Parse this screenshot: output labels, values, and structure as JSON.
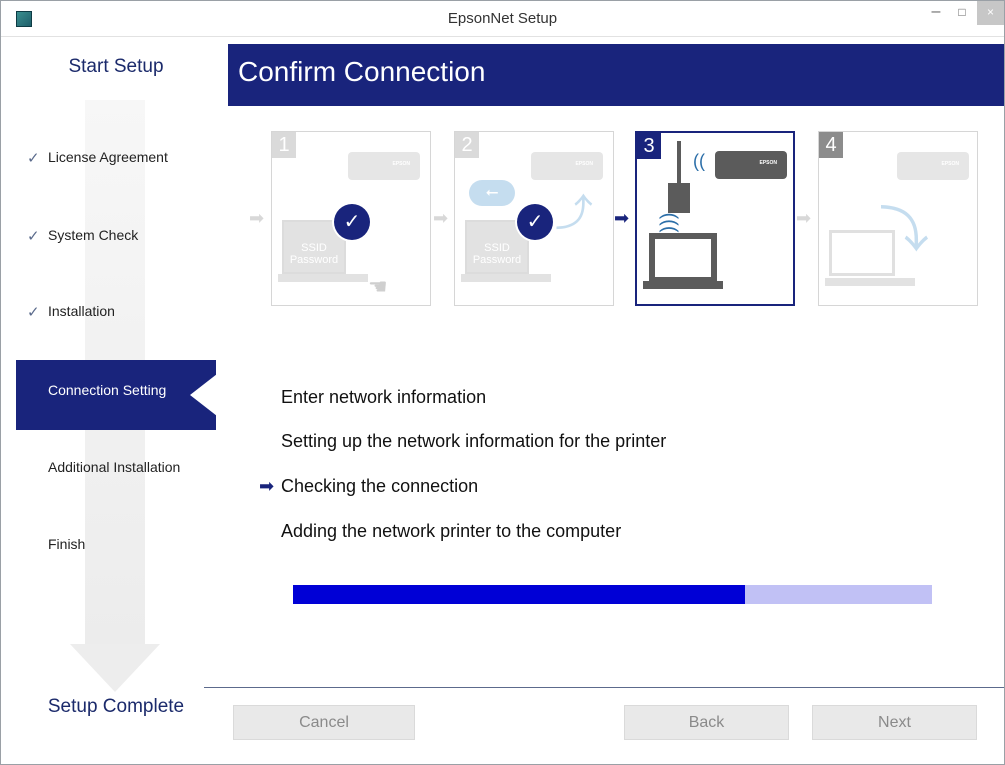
{
  "window": {
    "title": "EpsonNet Setup",
    "minimize_glyph": "–",
    "maximize_glyph": "□",
    "close_glyph": "×",
    "icon": "app-icon"
  },
  "sidebar": {
    "top_label": "Start Setup",
    "bottom_label": "Setup Complete",
    "steps": [
      {
        "label": "License Agreement",
        "state": "done"
      },
      {
        "label": "System Check",
        "state": "done"
      },
      {
        "label": "Installation",
        "state": "done"
      },
      {
        "label": "Connection Setting",
        "state": "active"
      },
      {
        "label": "Additional Installation",
        "state": "pending"
      },
      {
        "label": "Finish",
        "state": "pending"
      }
    ],
    "check_glyph": "✓"
  },
  "header": {
    "title": "Confirm Connection"
  },
  "diagrams": {
    "panels": [
      {
        "number": "1",
        "ssid": "SSID",
        "password": "Password",
        "printer_brand": "EPSON"
      },
      {
        "number": "2",
        "ssid": "SSID",
        "password": "Password",
        "printer_brand": "EPSON"
      },
      {
        "number": "3",
        "printer_brand": "EPSON"
      },
      {
        "number": "4",
        "printer_brand": "EPSON"
      }
    ],
    "current_panel": 3
  },
  "status": {
    "items": [
      "Enter network information",
      "Setting up the network information for the printer",
      "Checking the connection",
      "Adding the network printer to the computer"
    ],
    "current_index": 2,
    "pointer_glyph": "➡"
  },
  "progress": {
    "fraction": 0.707,
    "fill_color": "#0000d6",
    "track_color": "#c1c1f5"
  },
  "buttons": {
    "cancel": "Cancel",
    "back": "Back",
    "next": "Next"
  },
  "colors": {
    "accent": "#19247c"
  }
}
